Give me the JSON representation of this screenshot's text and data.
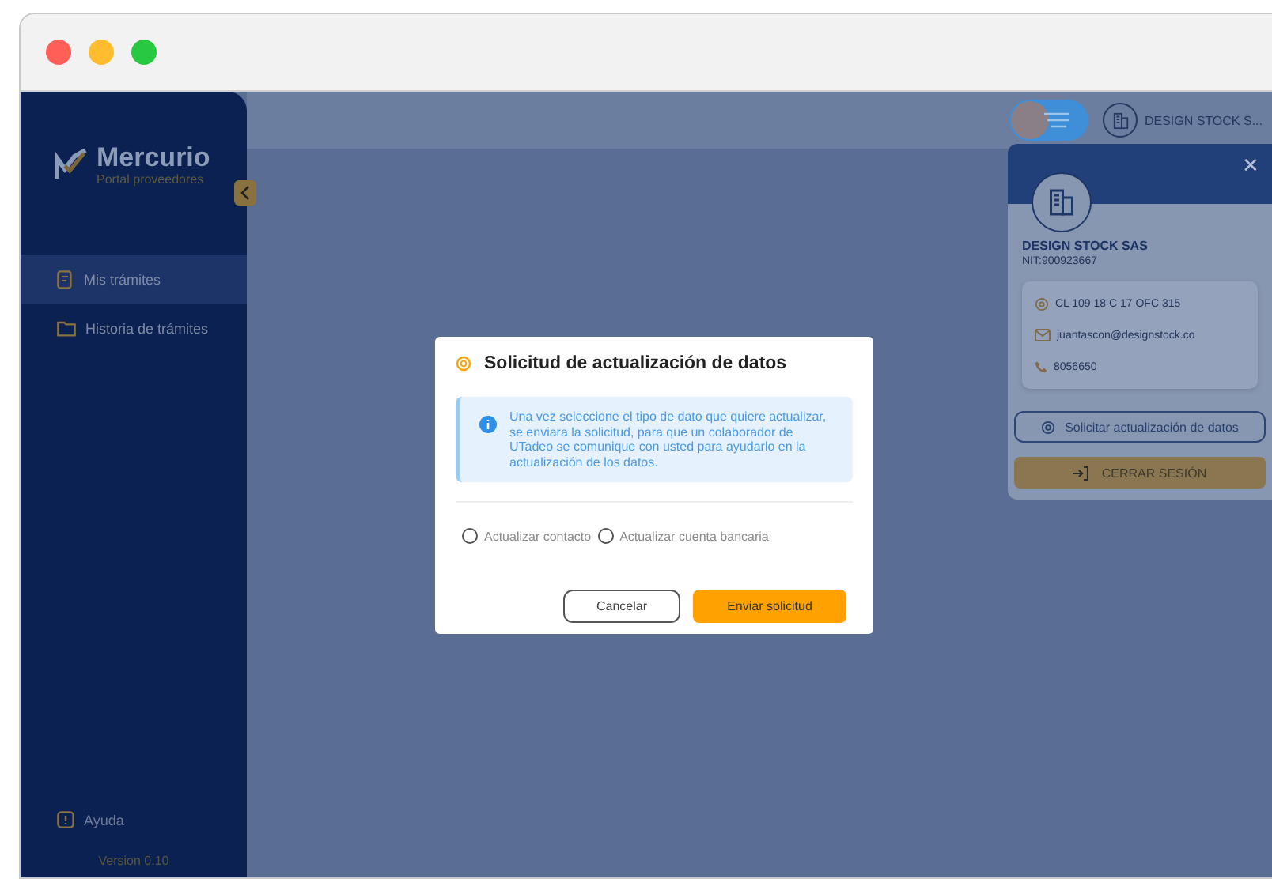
{
  "window": {
    "controls": [
      {
        "color": "#ff5f57"
      },
      {
        "color": "#febc2e"
      },
      {
        "color": "#28c840"
      }
    ]
  },
  "sidebar": {
    "logo": {
      "title": "Mercurio",
      "subtitle": "Portal proveedores"
    },
    "items": [
      {
        "label": "Mis trámites",
        "selected": true,
        "kind": "document"
      },
      {
        "label": "Historia de trámites",
        "selected": false,
        "kind": "folder"
      }
    ],
    "help": "Ayuda",
    "version": "Version 0.10"
  },
  "topbar": {
    "company": "DESIGN STOCK S..."
  },
  "profile_panel": {
    "close": "✕",
    "name": "DESIGN STOCK SAS",
    "nit": "NIT:900923667",
    "contacts": [
      {
        "kind": "address",
        "text": "CL 109 18 C 17 OFC 315"
      },
      {
        "kind": "email",
        "text": "juantascon@designstock.co"
      },
      {
        "kind": "phone",
        "text": "8056650"
      }
    ],
    "request_button": "Solicitar actualización de datos",
    "logout_button": "CERRAR SESIÓN"
  },
  "dialog": {
    "title": "Solicitud de actualización de datos",
    "info": "Una vez seleccione el tipo de dato que quiere actualizar, se enviara la solicitud, para que un colaborador de UTadeo se comunique con usted para ayudarlo en la actualización de los datos.",
    "options": [
      {
        "label": "Actualizar contacto",
        "selected": false
      },
      {
        "label": "Actualizar cuenta bancaria",
        "selected": false
      }
    ],
    "cancel": "Cancelar",
    "submit": "Enviar solicitud"
  }
}
